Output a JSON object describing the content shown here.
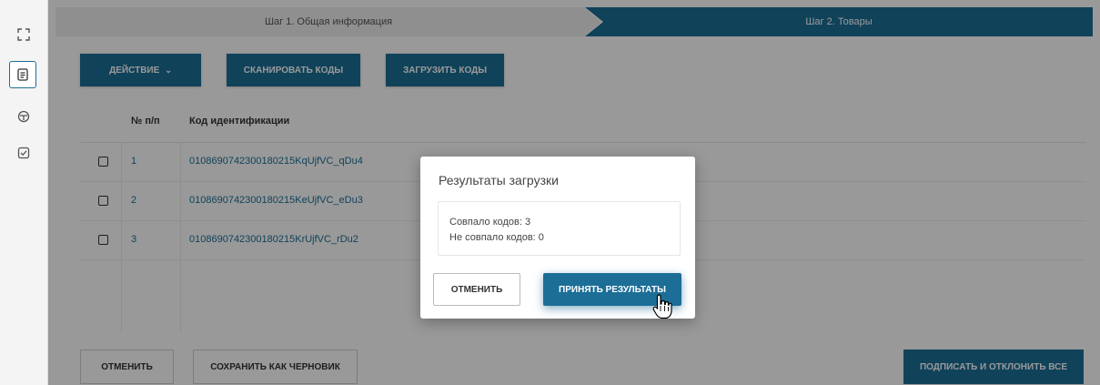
{
  "sidebar": {
    "icons": [
      "expand-icon",
      "document-icon",
      "box-icon",
      "check-square-icon"
    ]
  },
  "steps": {
    "step1": "Шаг 1. Общая информация",
    "step2": "Шаг 2. Товары"
  },
  "toolbar": {
    "action_label": "ДЕЙСТВИЕ",
    "scan_label": "СКАНИРОВАТЬ КОДЫ",
    "upload_label": "ЗАГРУЗИТЬ КОДЫ"
  },
  "table": {
    "columns": [
      "№ п/п",
      "Код идентификации"
    ],
    "rows": [
      {
        "num": "1",
        "code": "0108690742300180215KqUjfVC_qDu4"
      },
      {
        "num": "2",
        "code": "0108690742300180215KeUjfVC_eDu3"
      },
      {
        "num": "3",
        "code": "0108690742300180215KrUjfVC_rDu2"
      }
    ]
  },
  "footer": {
    "cancel_label": "ОТМЕНИТЬ",
    "draft_label": "СОХРАНИТЬ КАК ЧЕРНОВИК",
    "sign_label": "ПОДПИСАТЬ И ОТКЛОНИТЬ ВСЕ"
  },
  "modal": {
    "title": "Результаты загрузки",
    "matched": "Совпало кодов: 3",
    "unmatched": "Не совпало кодов: 0",
    "cancel_label": "ОТМЕНИТЬ",
    "accept_label": "ПРИНЯТЬ РЕЗУЛЬТАТЫ"
  },
  "colors": {
    "accent": "#1c6e96",
    "overlay": "rgba(0,0,0,0.40)"
  }
}
